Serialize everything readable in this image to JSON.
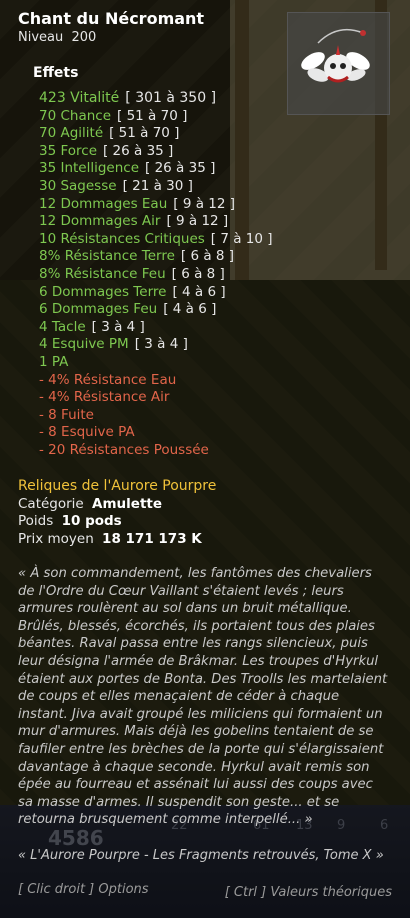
{
  "item": {
    "name": "Chant du Nécromant",
    "level_label": "Niveau",
    "level_value": "200"
  },
  "effects_label": "Effets",
  "effects": [
    {
      "text": "423 Vitalité",
      "range": "[ 301 à 350 ]",
      "type": "positive"
    },
    {
      "text": "70 Chance",
      "range": "[ 51 à 70 ]",
      "type": "positive"
    },
    {
      "text": "70 Agilité",
      "range": "[ 51 à 70 ]",
      "type": "positive"
    },
    {
      "text": "35 Force",
      "range": "[ 26 à 35 ]",
      "type": "positive"
    },
    {
      "text": "35 Intelligence",
      "range": "[ 26 à 35 ]",
      "type": "positive"
    },
    {
      "text": "30 Sagesse",
      "range": "[ 21 à 30 ]",
      "type": "positive"
    },
    {
      "text": "12 Dommages Eau",
      "range": "[ 9 à 12 ]",
      "type": "positive"
    },
    {
      "text": "12 Dommages Air",
      "range": "[ 9 à 12 ]",
      "type": "positive"
    },
    {
      "text": "10 Résistances Critiques",
      "range": "[ 7 à 10 ]",
      "type": "positive"
    },
    {
      "text": "8% Résistance Terre",
      "range": "[ 6 à 8 ]",
      "type": "positive"
    },
    {
      "text": "8% Résistance Feu",
      "range": "[ 6 à 8 ]",
      "type": "positive"
    },
    {
      "text": "6 Dommages Terre",
      "range": "[ 4 à 6 ]",
      "type": "positive"
    },
    {
      "text": "6 Dommages Feu",
      "range": "[ 4 à 6 ]",
      "type": "positive"
    },
    {
      "text": "4 Tacle",
      "range": "[ 3 à 4 ]",
      "type": "positive"
    },
    {
      "text": "4 Esquive PM",
      "range": "[ 3 à 4 ]",
      "type": "positive"
    },
    {
      "text": "1 PA",
      "range": "",
      "type": "positive"
    },
    {
      "text": "- 4% Résistance Eau",
      "range": "",
      "type": "negative"
    },
    {
      "text": "- 4% Résistance Air",
      "range": "",
      "type": "negative"
    },
    {
      "text": "- 8 Fuite",
      "range": "",
      "type": "negative"
    },
    {
      "text": "- 8 Esquive PA",
      "range": "",
      "type": "negative"
    },
    {
      "text": "- 20 Résistances Poussée",
      "range": "",
      "type": "negative"
    }
  ],
  "set_name": "Reliques de l'Aurore Pourpre",
  "category": {
    "label": "Catégorie",
    "value": "Amulette"
  },
  "weight": {
    "label": "Poids",
    "value": "10 pods"
  },
  "price": {
    "label": "Prix moyen",
    "value": "18 171 173 K"
  },
  "description": "« À son commandement, les fantômes des chevaliers de l'Ordre du Cœur Vaillant s'étaient levés ; leurs armures roulèrent au sol dans un bruit métallique. Brûlés, blessés, écorchés, ils portaient tous des plaies béantes. Raval passa entre les rangs silencieux, puis leur désigna l'armée de Brâkmar. Les troupes d'Hyrkul étaient aux portes de Bonta. Des Troolls les martelaient de coups et elles menaçaient de céder à chaque instant. Jiva avait groupé les miliciens qui formaient un mur d'armures. Mais déjà les gobelins tentaient de se faufiler entre les brèches de la porte qui s'élargissaient davantage à chaque seconde. Hyrkul avait remis son épée au fourreau et assénait lui aussi des coups avec sa masse d'armes. Il suspendit son geste... et se retourna brusquement comme interpellé... »",
  "source": "« L'Aurore Pourpre - Les Fragments retrouvés, Tome X »",
  "hints": {
    "left": "[ Clic droit ] Options",
    "right": "[ Ctrl ] Valeurs théoriques"
  },
  "hud": {
    "big_number": "4586",
    "numbers": [
      "22",
      "61",
      "13",
      "9",
      "6"
    ]
  },
  "colors": {
    "positive": "#7ec850",
    "negative": "#e2654a",
    "set": "#f0c23a"
  }
}
